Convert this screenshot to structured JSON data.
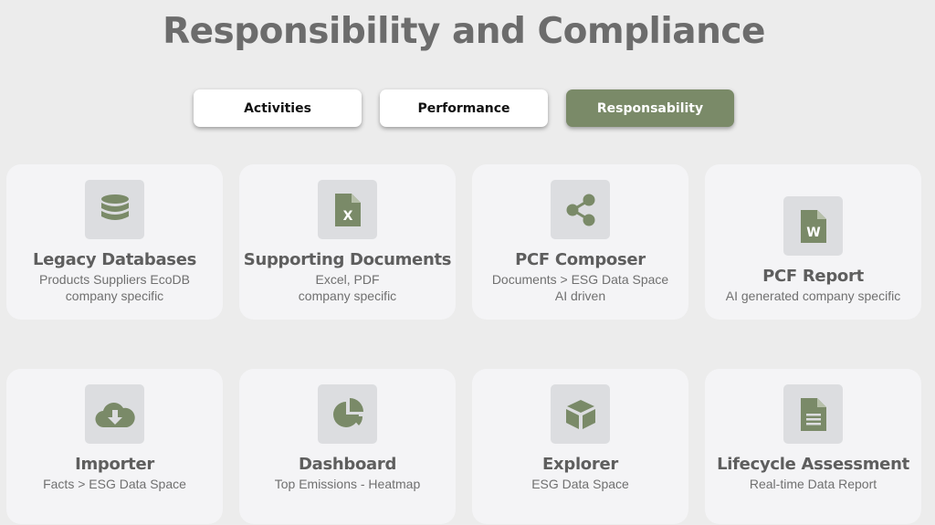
{
  "page_title": "Responsibility and Compliance",
  "tabs": [
    {
      "label": "Activities",
      "active": false
    },
    {
      "label": "Performance",
      "active": false
    },
    {
      "label": "Responsability",
      "active": true
    }
  ],
  "colors": {
    "accent": "#7a8a68",
    "icon": "#7a8a68",
    "background": "#ececec",
    "card": "#f4f4f6"
  },
  "cards": [
    {
      "title": "Legacy Databases",
      "line1": "Products Suppliers EcoDB",
      "line2": "company specific",
      "icon": "database-icon"
    },
    {
      "title": "Supporting Documents",
      "line1": "Excel, PDF",
      "line2": "company specific",
      "icon": "excel-file-icon"
    },
    {
      "title": "PCF Composer",
      "line1": "Documents > ESG Data Space",
      "line2": "AI driven",
      "icon": "share-nodes-icon"
    },
    {
      "title": "PCF Report",
      "line1": "AI generated company specific",
      "icon": "word-file-icon"
    },
    {
      "title": "Importer",
      "line1": "Facts > ESG Data Space",
      "icon": "cloud-download-icon"
    },
    {
      "title": "Dashboard",
      "line1": "Top Emissions - Heatmap",
      "icon": "pie-chart-icon"
    },
    {
      "title": "Explorer",
      "line1": "ESG Data Space",
      "icon": "cube-icon"
    },
    {
      "title": "Lifecycle Assessment",
      "line1": "Real-time Data Report",
      "icon": "document-icon"
    }
  ]
}
